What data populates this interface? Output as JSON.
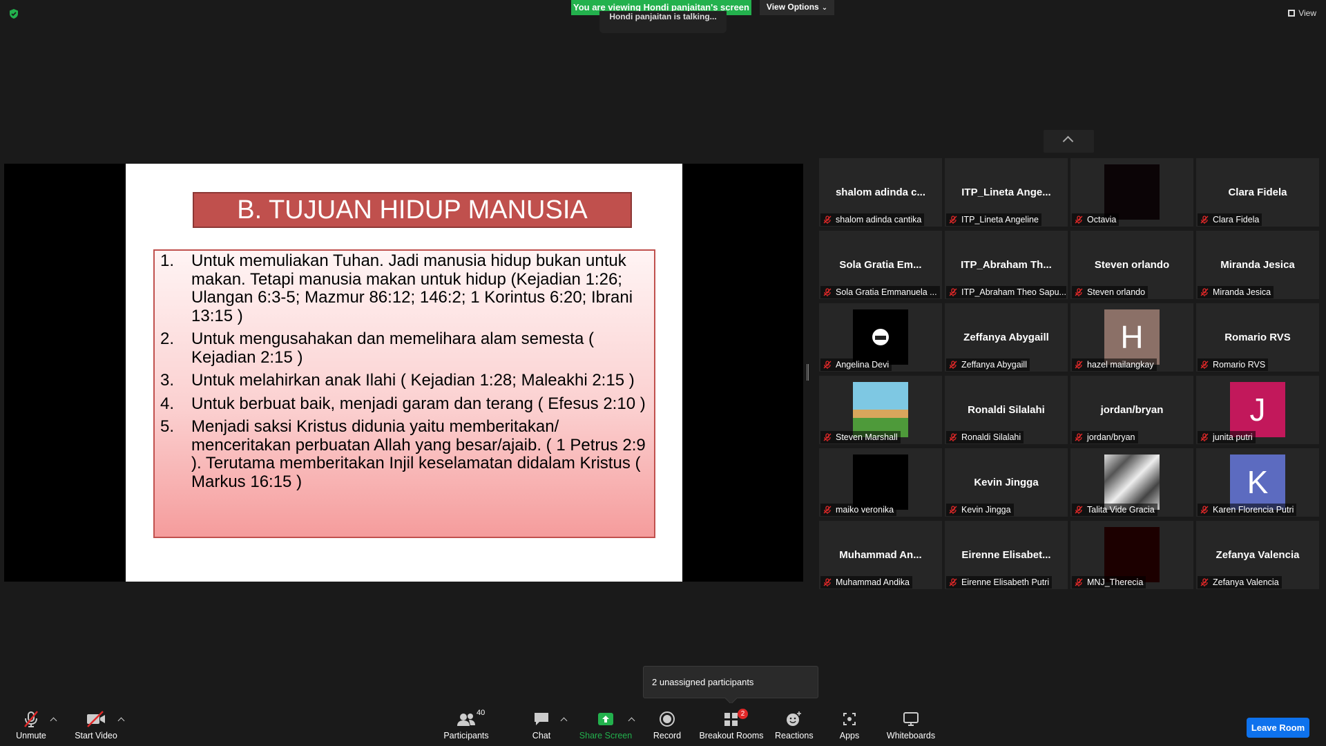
{
  "top": {
    "viewing_banner": "You are viewing Hondi panjaitan's screen",
    "view_options": "View Options",
    "talking": "Hondi panjaitan is talking...",
    "view_label": "View"
  },
  "slide": {
    "title": "B. TUJUAN HIDUP MANUSIA",
    "items": [
      {
        "num": "1.",
        "text": "Untuk memuliakan Tuhan. Jadi manusia hidup bukan untuk makan. Tetapi manusia makan untuk hidup (Kejadian 1:26; Ulangan 6:3-5; Mazmur 86:12; 146:2;  1 Korintus 6:20; Ibrani 13:15 )"
      },
      {
        "num": "2.",
        "text": "Untuk mengusahakan dan memelihara alam semesta ( Kejadian 2:15 )"
      },
      {
        "num": "3.",
        "text": "Untuk melahirkan anak Ilahi ( Kejadian 1:28; Maleakhi 2:15 )"
      },
      {
        "num": "4.",
        "text": "Untuk berbuat baik, menjadi garam dan terang  ( Efesus 2:10 )"
      },
      {
        "num": "5.",
        "text": "Menjadi saksi Kristus didunia yaitu memberitakan/ menceritakan perbuatan Allah yang besar/ajaib. ( 1 Petrus 2:9 ).  Terutama memberitakan Injil keselamatan didalam Kristus ( Markus 16:15 )"
      }
    ]
  },
  "participants": [
    {
      "big": "shalom  adinda  c...",
      "label": "shalom adinda cantika",
      "avatar": ""
    },
    {
      "big": "ITP_Lineta  Ange...",
      "label": "ITP_Lineta Angeline",
      "avatar": ""
    },
    {
      "big": "",
      "label": "Octavia",
      "avatar": "dark"
    },
    {
      "big": "Clara Fidela",
      "label": "Clara Fidela",
      "avatar": ""
    },
    {
      "big": "Sola  Gratia  Em...",
      "label": "Sola Gratia Emmanuela ...",
      "avatar": ""
    },
    {
      "big": "ITP_Abraham  Th...",
      "label": "ITP_Abraham Theo Sapu...",
      "avatar": ""
    },
    {
      "big": "Steven orlando",
      "label": "Steven orlando",
      "avatar": ""
    },
    {
      "big": "Miranda Jesica",
      "label": "Miranda Jesica",
      "avatar": ""
    },
    {
      "big": "",
      "label": "Angelina Devi",
      "avatar": "white-ic"
    },
    {
      "big": "Zeffanya Abygaill",
      "label": "Zeffanya Abygaill",
      "avatar": ""
    },
    {
      "big": "",
      "label": "hazel mailangkay",
      "avatar": "brown",
      "letter": "H"
    },
    {
      "big": "Romario RVS",
      "label": "Romario RVS",
      "avatar": ""
    },
    {
      "big": "",
      "label": "Steven Marshall",
      "avatar": "tree"
    },
    {
      "big": "Ronaldi Silalahi",
      "label": "Ronaldi Silalahi",
      "avatar": ""
    },
    {
      "big": "jordan/bryan",
      "label": "jordan/bryan",
      "avatar": ""
    },
    {
      "big": "",
      "label": "junita putri",
      "avatar": "pink",
      "letter": "J"
    },
    {
      "big": "",
      "label": "maiko veronika",
      "avatar": "black"
    },
    {
      "big": "Kevin Jingga",
      "label": "Kevin Jingga",
      "avatar": ""
    },
    {
      "big": "",
      "label": "Talita Vide Gracia",
      "avatar": "photo"
    },
    {
      "big": "",
      "label": "Karen Florencia Putri",
      "avatar": "blue",
      "letter": "K"
    },
    {
      "big": "Muhammad  An...",
      "label": "Muhammad Andika",
      "avatar": ""
    },
    {
      "big": "Eirenne  Elisabet...",
      "label": "Eirenne Elisabeth Putri",
      "avatar": ""
    },
    {
      "big": "",
      "label": "MNJ_Therecia",
      "avatar": "darkred"
    },
    {
      "big": "Zefanya Valencia",
      "label": "Zefanya Valencia",
      "avatar": ""
    }
  ],
  "tooltip": "2 unassigned participants",
  "toolbar": {
    "unmute": "Unmute",
    "start_video": "Start Video",
    "participants": "Participants",
    "participants_count": "40",
    "chat": "Chat",
    "share_screen": "Share Screen",
    "record": "Record",
    "breakout_rooms": "Breakout Rooms",
    "breakout_badge": "2",
    "reactions": "Reactions",
    "apps": "Apps",
    "whiteboards": "Whiteboards",
    "leave": "Leave Room"
  },
  "colors": {
    "banner_green": "#23b14d",
    "share_green": "#23b14d",
    "leave_blue": "#0e72ed",
    "mute_red": "#e02828",
    "slide_title_red": "#c0504d"
  }
}
